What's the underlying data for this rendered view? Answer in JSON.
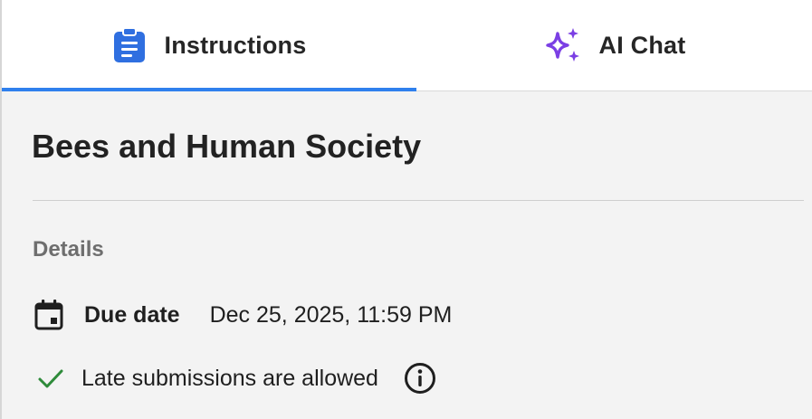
{
  "tabs": [
    {
      "label": "Instructions",
      "icon": "clipboard-icon",
      "active": true,
      "icon_color": "#2f6fe0"
    },
    {
      "label": "AI Chat",
      "icon": "sparkles-icon",
      "active": false,
      "icon_color": "#7b3fe4"
    }
  ],
  "assignment": {
    "title": "Bees and Human Society"
  },
  "details": {
    "heading": "Details",
    "due_label": "Due date",
    "due_value": "Dec 25, 2025, 11:59 PM",
    "late_text": "Late submissions are allowed",
    "check_color": "#2e8b3a"
  },
  "colors": {
    "accent": "#2f80ed",
    "background": "#f3f3f3"
  }
}
